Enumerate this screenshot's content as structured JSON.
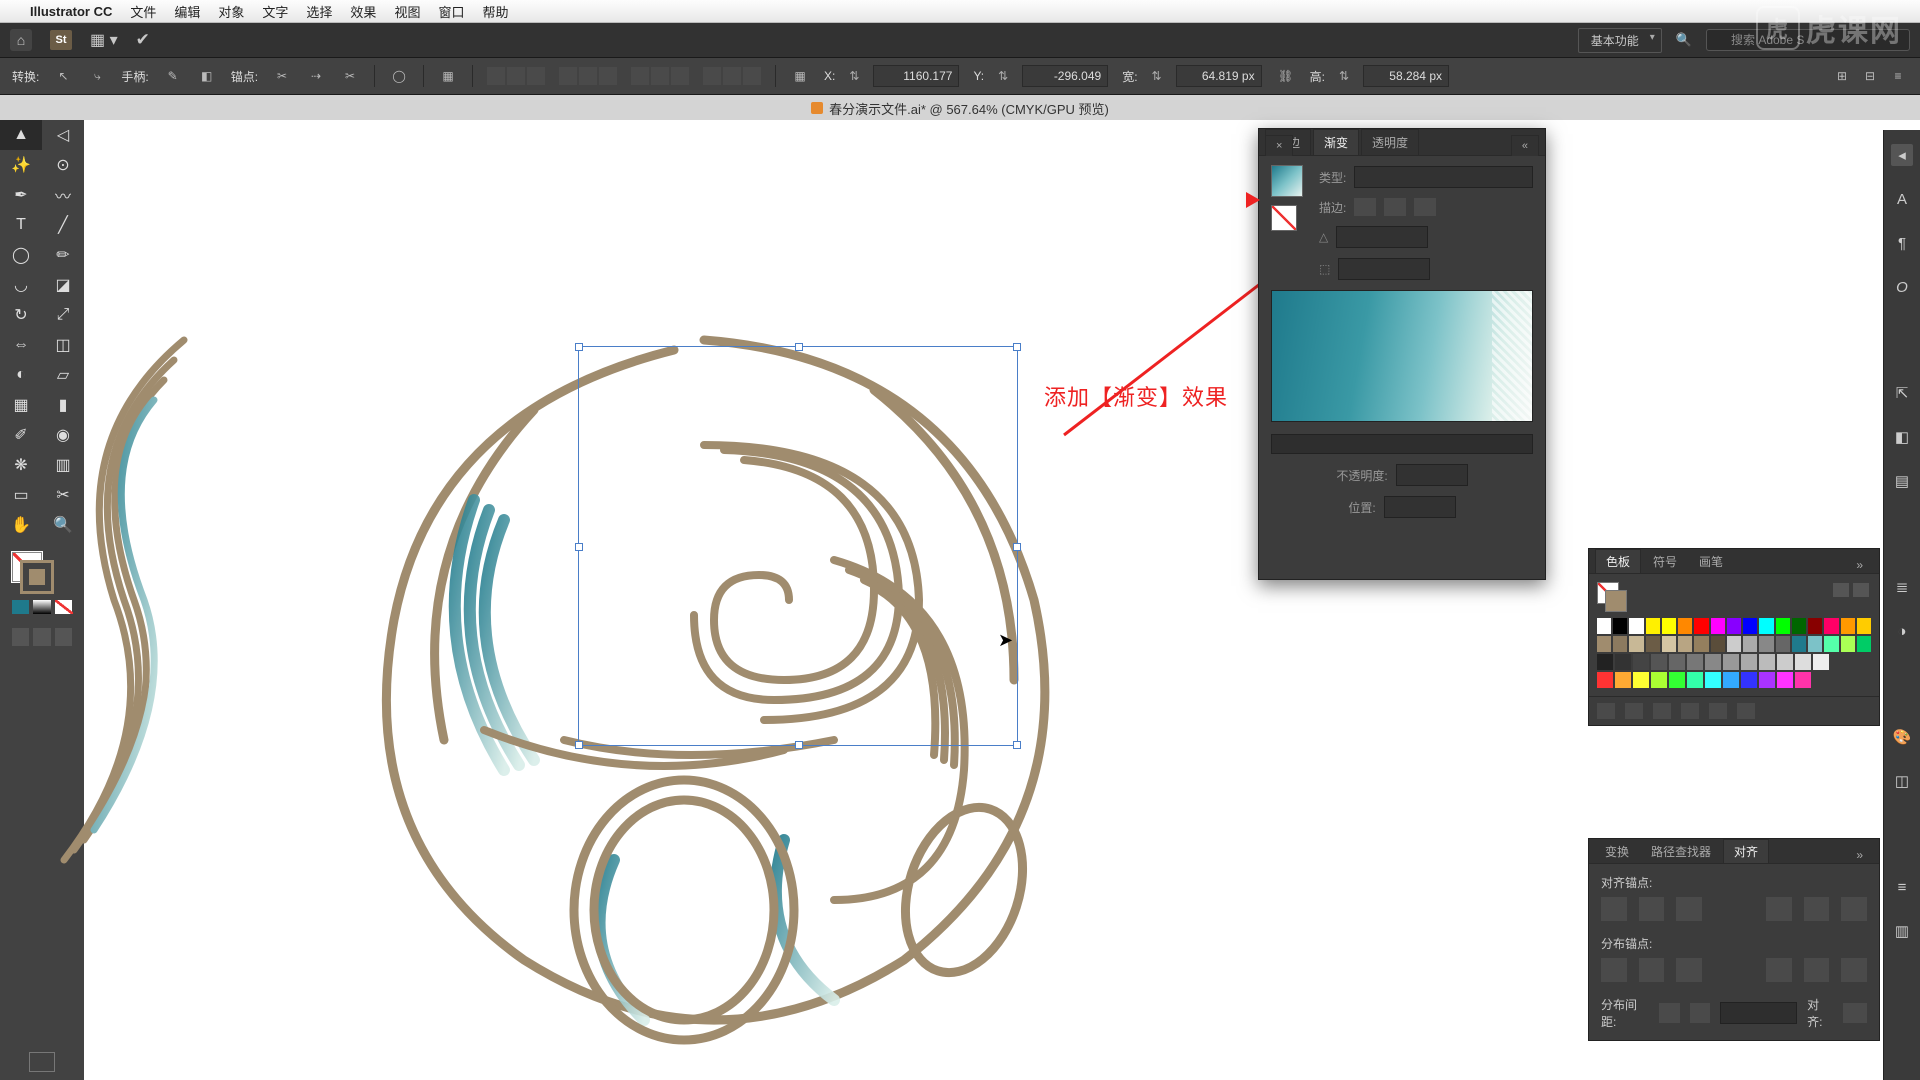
{
  "menubar": {
    "app": "Illustrator CC",
    "items": [
      "文件",
      "编辑",
      "对象",
      "文字",
      "选择",
      "效果",
      "视图",
      "窗口",
      "帮助"
    ]
  },
  "appbar": {
    "layout_label": "基本功能",
    "search_placeholder": "搜索 Adobe S"
  },
  "controlbar": {
    "transform_label": "转换:",
    "handle_label": "手柄:",
    "anchor_label": "锚点:",
    "x_label": "X:",
    "x_val": "1160.177",
    "y_label": "Y:",
    "y_val": "-296.049",
    "w_label": "宽:",
    "w_val": "64.819 px",
    "h_label": "高:",
    "h_val": "58.284 px"
  },
  "document_tab": "春分演示文件.ai* @ 567.64% (CMYK/GPU 预览)",
  "annotation": "添加【渐变】效果",
  "gradient_panel": {
    "tab_stroke": "描边",
    "tab_gradient": "渐变",
    "tab_transparency": "透明度",
    "type_label": "类型:",
    "stroke_label": "描边:",
    "opacity_label": "不透明度:",
    "location_label": "位置:"
  },
  "swatches_panel": {
    "tab_swatches": "色板",
    "tab_symbols": "符号",
    "tab_brushes": "画笔"
  },
  "align_panel": {
    "tab_transform": "变换",
    "tab_pathfinder": "路径查找器",
    "tab_align": "对齐",
    "align_anchor_label": "对齐锚点:",
    "dist_anchor_label": "分布锚点:",
    "dist_spacing_label": "分布间距:",
    "align_to_label": "对齐:"
  },
  "watermark": "虎课网",
  "swatch_colors": [
    [
      "#fff",
      "#000",
      "#fff",
      "#fff000",
      "#ff0",
      "#f80",
      "#f00",
      "#f0f",
      "#80f",
      "#00f",
      "#0ff",
      "#0f0",
      "#060",
      "#800",
      "#f06",
      "#f90",
      "#fc0"
    ],
    [
      "#a08c6e",
      "#8c7a5f",
      "#c8b896",
      "#6b5c46",
      "#d4c5a3",
      "#b8a583",
      "#947f5e",
      "#5a4d3a",
      "#ccc",
      "#aaa",
      "#888",
      "#666",
      "#1f7a8c",
      "#7cc2c8",
      "#5fa",
      "#af5",
      "#0c6"
    ],
    [
      "#222",
      "#333",
      "#444",
      "#555",
      "#666",
      "#777",
      "#888",
      "#999",
      "#aaa",
      "#bbb",
      "#ccc",
      "#ddd",
      "#eee"
    ],
    [
      "#f33",
      "#fa3",
      "#ff3",
      "#af3",
      "#3f3",
      "#3fa",
      "#3ff",
      "#3af",
      "#33f",
      "#a3f",
      "#f3f",
      "#f3a"
    ]
  ]
}
